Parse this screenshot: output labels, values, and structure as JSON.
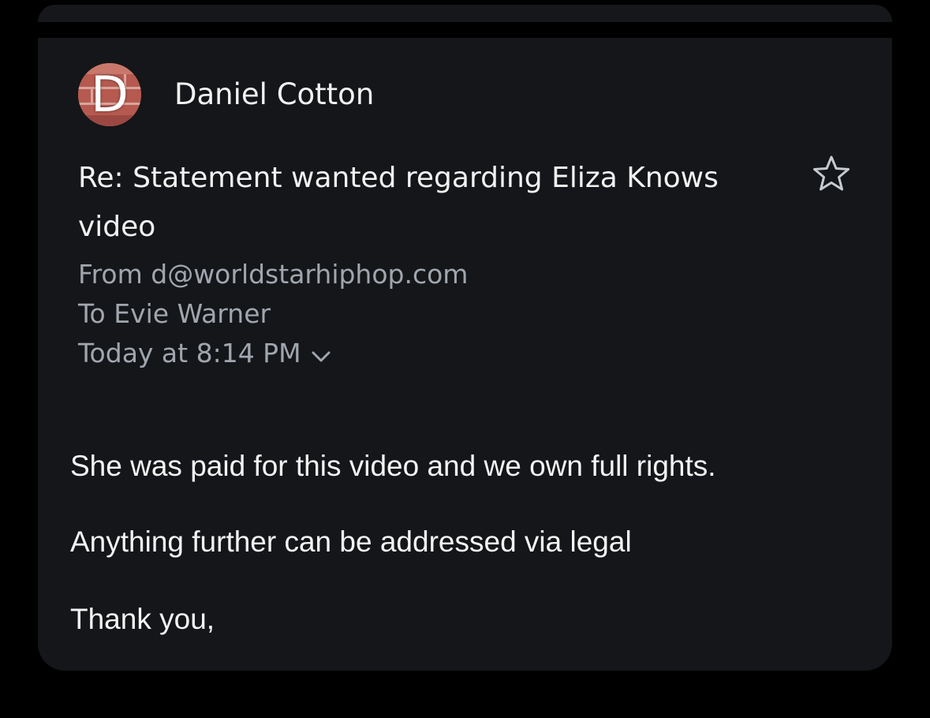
{
  "email": {
    "sender": {
      "name": "Daniel Cotton",
      "avatar_letter": "D"
    },
    "subject": "Re: Statement wanted regarding Eliza Knows video",
    "from_line": "From d@worldstarhiphop.com",
    "to_line": "To Evie Warner",
    "date_line": "Today at 8:14 PM",
    "body": [
      "She was paid for this video and we own full rights.",
      "Anything further can be addressed via legal",
      "Thank you,"
    ],
    "starred": false
  },
  "icons": {
    "star": "star-icon",
    "details_toggle": "chevron-down-icon"
  },
  "colors": {
    "background": "#000000",
    "card": "#141619",
    "primary_text": "#f2f2f2",
    "secondary_text": "#a1a6ae",
    "avatar_bg": "#b0584f"
  }
}
